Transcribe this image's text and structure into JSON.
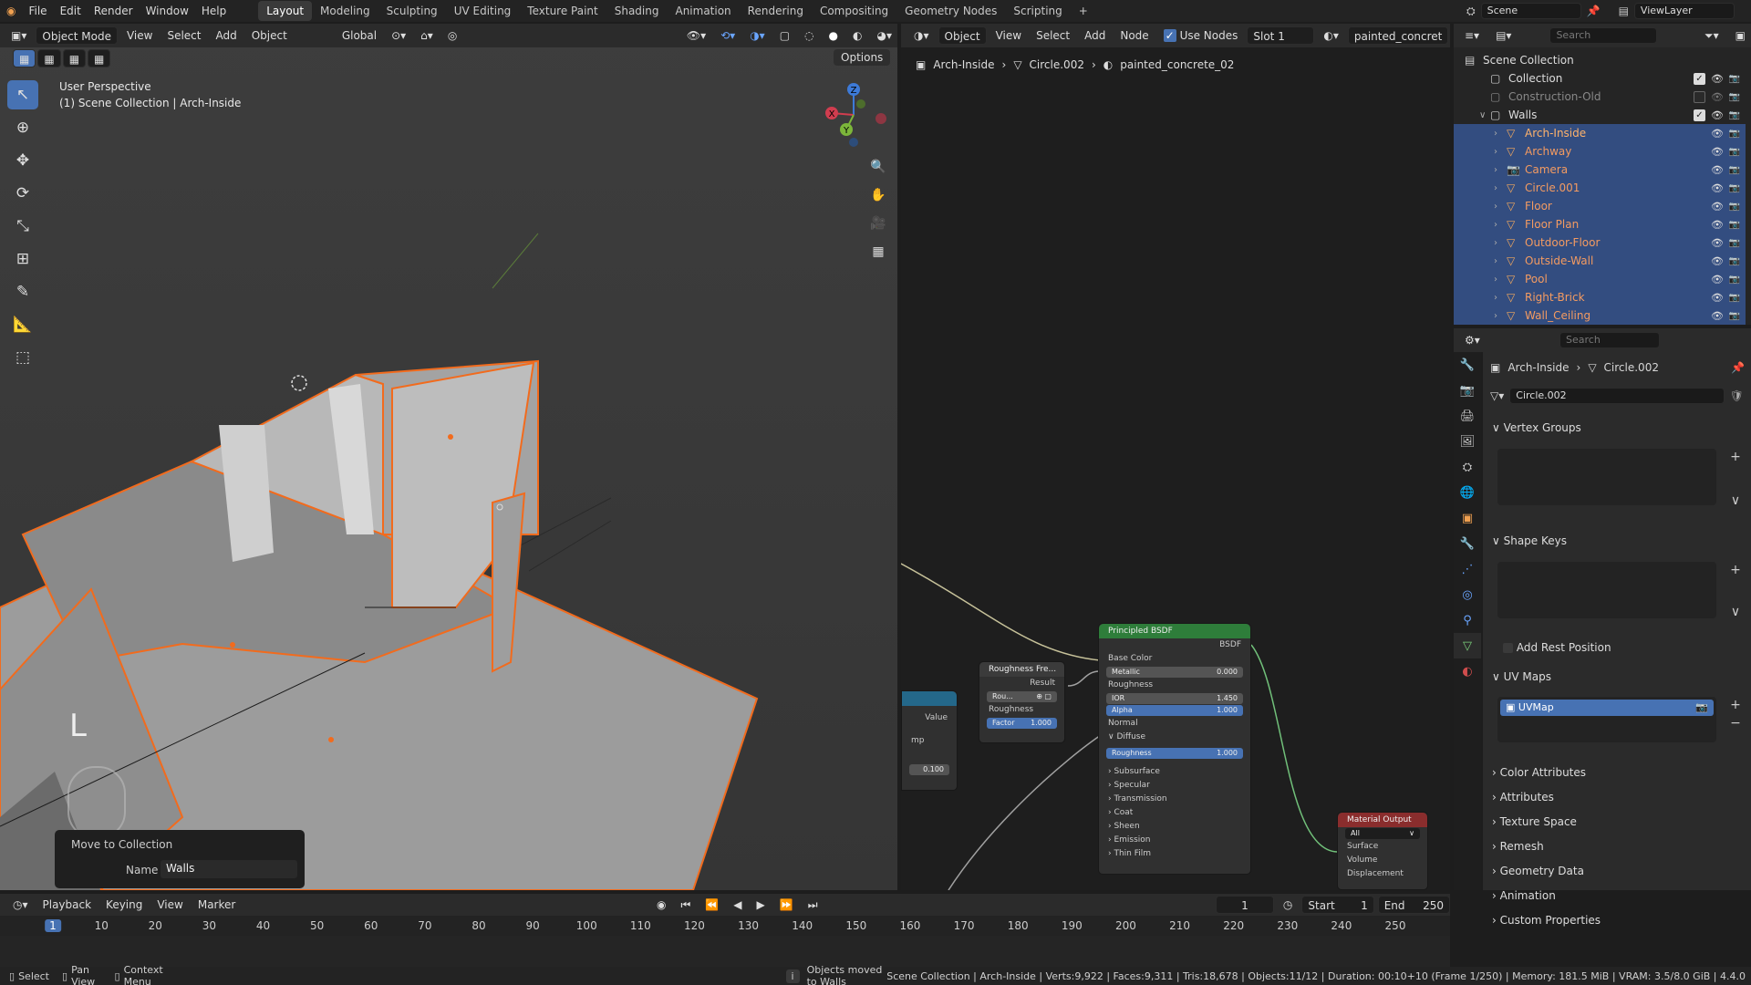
{
  "topbar": {
    "menus": [
      "File",
      "Edit",
      "Render",
      "Window",
      "Help"
    ],
    "workspaces": [
      "Layout",
      "Modeling",
      "Sculpting",
      "UV Editing",
      "Texture Paint",
      "Shading",
      "Animation",
      "Rendering",
      "Compositing",
      "Geometry Nodes",
      "Scripting"
    ],
    "active_workspace": "Layout",
    "scene": "Scene",
    "view_layer": "ViewLayer"
  },
  "viewport": {
    "mode": "Object Mode",
    "menus": [
      "View",
      "Select",
      "Add",
      "Object"
    ],
    "transform": "Global",
    "options": "Options",
    "perspective": "User Perspective",
    "context": "(1) Scene Collection | Arch-Inside",
    "gizmo": {
      "z": "Z",
      "y": "Y",
      "x": "X"
    },
    "redo_panel": {
      "title": "Move to Collection",
      "name_label": "Name",
      "name_value": "Walls"
    }
  },
  "node_editor": {
    "type": "Object",
    "menus": [
      "View",
      "Select",
      "Add",
      "Node"
    ],
    "use_nodes": "Use Nodes",
    "slot": "Slot 1",
    "material": "painted_concret",
    "breadcrumb": [
      "Arch-Inside",
      "Circle.002",
      "painted_concrete_02"
    ],
    "left_node": {
      "value": "Value",
      "mp": "mp",
      "num": "0.100"
    },
    "roughness_node": {
      "title": "Roughness Fre...",
      "result": "Result",
      "rou": "Rou...",
      "roughness": "Roughness",
      "factor_label": "Factor",
      "factor_value": "1.000"
    },
    "bsdf": {
      "title": "Principled BSDF",
      "output": "BSDF",
      "base_color": "Base Color",
      "metallic_label": "Metallic",
      "metallic": "0.000",
      "roughness": "Roughness",
      "ior_label": "IOR",
      "ior": "1.450",
      "alpha_label": "Alpha",
      "alpha": "1.000",
      "normal": "Normal",
      "diffuse": "Diffuse",
      "diff_rough_label": "Roughness",
      "diff_rough": "1.000",
      "sections": [
        "Subsurface",
        "Specular",
        "Transmission",
        "Coat",
        "Sheen",
        "Emission",
        "Thin Film"
      ]
    },
    "material_output": {
      "title": "Material Output",
      "target": "All",
      "sockets": [
        "Surface",
        "Volume",
        "Displacement"
      ]
    }
  },
  "outliner": {
    "search_placeholder": "Search",
    "root": "Scene Collection",
    "collections": [
      {
        "name": "Collection"
      },
      {
        "name": "Construction-Old"
      },
      {
        "name": "Walls"
      }
    ],
    "objects": [
      "Arch-Inside",
      "Archway",
      "Camera",
      "Circle.001",
      "Floor",
      "Floor Plan",
      "Outdoor-Floor",
      "Outside-Wall",
      "Pool",
      "Right-Brick",
      "Wall_Ceiling"
    ]
  },
  "properties": {
    "search_placeholder": "Search",
    "breadcrumb": [
      "Arch-Inside",
      "Circle.002"
    ],
    "mesh_name": "Circle.002",
    "sections": {
      "vertex_groups": "Vertex Groups",
      "shape_keys": "Shape Keys",
      "add_rest_position": "Add Rest Position",
      "uv_maps": "UV Maps",
      "uvmap_item": "UVMap",
      "collapsed": [
        "Color Attributes",
        "Attributes",
        "Texture Space",
        "Remesh",
        "Geometry Data",
        "Animation",
        "Custom Properties"
      ]
    }
  },
  "timeline": {
    "menus": [
      "Playback",
      "Keying",
      "View",
      "Marker"
    ],
    "current_frame": "1",
    "start_label": "Start",
    "start": "1",
    "end_label": "End",
    "end": "250",
    "ticks": [
      "1",
      "10",
      "20",
      "30",
      "40",
      "50",
      "60",
      "70",
      "80",
      "90",
      "100",
      "110",
      "120",
      "130",
      "140",
      "150",
      "160",
      "170",
      "180",
      "190",
      "200",
      "210",
      "220",
      "230",
      "240",
      "250"
    ]
  },
  "statusbar": {
    "select": "Select",
    "pan": "Pan View",
    "context": "Context Menu",
    "message": "Objects moved to Walls",
    "stats": "Scene Collection | Arch-Inside | Verts:9,922 | Faces:9,311 | Tris:18,678 | Objects:11/12 | Duration: 00:10+10 (Frame 1/250) | Memory: 181.5 MiB | VRAM: 3.5/8.0 GiB | 4.4.0"
  }
}
